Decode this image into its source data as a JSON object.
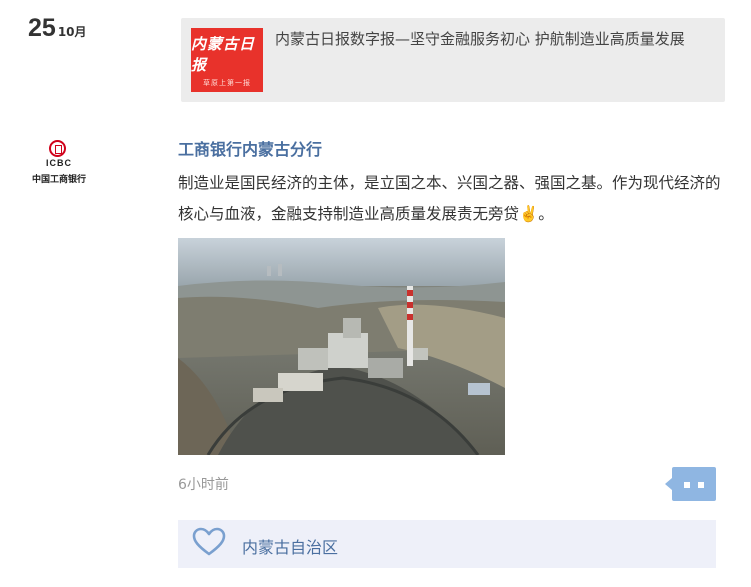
{
  "date": {
    "day": "25",
    "month": "10月"
  },
  "repost": {
    "thumb_logo": "内蒙古日报",
    "thumb_sub": "草原上第一报",
    "title": "内蒙古日报数字报—坚守金融服务初心 护航制造业高质量发展"
  },
  "author": {
    "name": "工商银行内蒙古分行",
    "avatar_en": "ICBC",
    "avatar_cn": "中国工商银行"
  },
  "post": {
    "text": "制造业是国民经济的主体，是立国之本、兴国之器、强国之基。作为现代经济的核心与血液，金融支持制造业高质量发展责无旁贷✌️。"
  },
  "meta": {
    "time": "6小时前",
    "location": "内蒙古自治区"
  },
  "colors": {
    "accent": "#4a6fa0",
    "icbc_red": "#d0021b",
    "comment_btn": "#8fb6e2",
    "likebar_bg": "#eef0f9"
  }
}
